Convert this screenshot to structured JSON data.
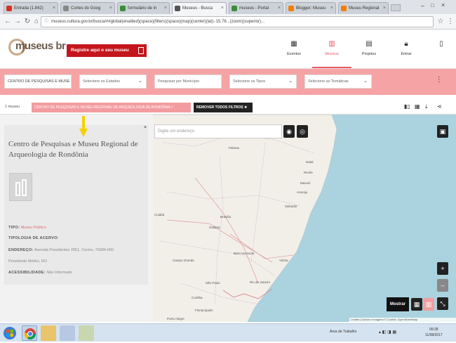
{
  "browser": {
    "tabs": [
      {
        "label": "Entrada (1.842)",
        "favicon_color": "#d93025"
      },
      {
        "label": "Cortes do Goog",
        "favicon_color": "#888888"
      },
      {
        "label": "formulário de in",
        "favicon_color": "#3b8c3b"
      },
      {
        "label": "Museus - Busca",
        "favicon_color": "#555555"
      },
      {
        "label": "museus - Portal",
        "favicon_color": "#3b8c3b"
      },
      {
        "label": "Blogger: Museu",
        "favicon_color": "#f57d00"
      },
      {
        "label": "Museu Regional",
        "favicon_color": "#f57d00"
      }
    ],
    "url": "museus.cultura.gov.br/busca/##global(enabled)(space)(filters)(space)(map)(center)(lat):-15.76...(zoom)(superior)..."
  },
  "header": {
    "logo": "museus br",
    "register_button": "Registre aqui o seu museu",
    "nav": [
      {
        "label": "Eventos",
        "icon": "calendar-icon"
      },
      {
        "label": "Museus",
        "icon": "building-icon",
        "active": true
      },
      {
        "label": "Projetos",
        "icon": "document-icon"
      },
      {
        "label": "Entrar",
        "icon": "lock-icon"
      },
      {
        "label": "",
        "icon": "file-icon"
      }
    ]
  },
  "filters": {
    "search_value": "CENTRO DE PESQUISAS E MUSE",
    "states_placeholder": "Selecione os Estados",
    "municipality_placeholder": "Pesquisar por Município",
    "types_placeholder": "Selecione os Tipos",
    "themes_placeholder": "Selecione as Temáticas"
  },
  "results": {
    "count": "1 museu",
    "active_filter": "CENTRO DE PESQUISAS E MUSEU REGIONAL DE ARQUEOLOGIA DE RONDÔNIA ×",
    "remove_filters": "REMOVER TODOS FILTROS ✖"
  },
  "card": {
    "title": "Centro de Pesquisas e Museu Regional de Arqueologia de Rondônia",
    "tipo_label": "TIPO:",
    "tipo_value": "Museu Público",
    "tipologia_label": "TIPOLOGIA DE ACERVO:",
    "endereco_label": "ENDEREÇO:",
    "endereco_value": "Avenida Presidentes 2061, Centro, 76984-000",
    "city_line": "Presidente Médici, RO",
    "acessibilidade_label": "ACESSIBILIDADE:",
    "acessibilidade_value": "Não Informado"
  },
  "map": {
    "search_placeholder": "Digite um endereço",
    "mostrar_button": "Mostrar",
    "attribution": "Leaflet | Dados e Imagens © Contrib. OpenStreetMap",
    "cities": [
      "Natal",
      "Recife",
      "Maceió",
      "Aracaju",
      "Salvador",
      "Brasília",
      "Goiânia",
      "Cuiabá",
      "Campo Grande",
      "Belo Horizonte",
      "Vitória",
      "Rio de Janeiro",
      "São Paulo",
      "Curitiba",
      "Florianópolis",
      "Porto Alegre",
      "Palmas",
      "Teresina"
    ]
  },
  "taskbar": {
    "notification_area": "Área de Trabalho",
    "clock_time": "09:28",
    "clock_date": "11/08/2017"
  }
}
